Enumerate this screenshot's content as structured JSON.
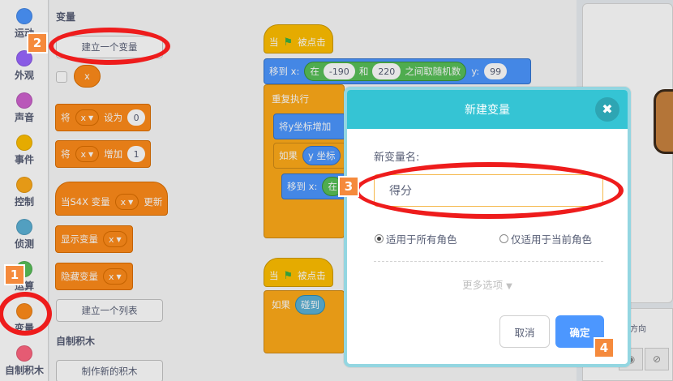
{
  "categories": [
    {
      "label": "运动",
      "color": "#4c97ff"
    },
    {
      "label": "外观",
      "color": "#9966ff"
    },
    {
      "label": "声音",
      "color": "#cf63cf"
    },
    {
      "label": "事件",
      "color": "#ffbf00"
    },
    {
      "label": "控制",
      "color": "#ffab19"
    },
    {
      "label": "侦测",
      "color": "#5cb1d6"
    },
    {
      "label": "运算",
      "color": "#59c059"
    },
    {
      "label": "变量",
      "color": "#ff8c1a"
    },
    {
      "label": "自制积木",
      "color": "#ff6680"
    }
  ],
  "palette": {
    "heading_variables": "变量",
    "make_variable_button": "建立一个变量",
    "var_reporter": "x",
    "set_block": {
      "verb": "将",
      "var": "x",
      "op": "设为",
      "value": "0"
    },
    "change_block": {
      "verb": "将",
      "var": "x",
      "op": "增加",
      "value": "1"
    },
    "when_var_block": {
      "prefix": "当S4X 变量",
      "var": "x",
      "suffix": "更新"
    },
    "show_var_block": {
      "label": "显示变量",
      "var": "x"
    },
    "hide_var_block": {
      "label": "隐藏变量",
      "var": "x"
    },
    "make_list_button": "建立一个列表",
    "heading_custom": "自制积木",
    "make_block_button": "制作新的积木"
  },
  "code": {
    "hat1": {
      "prefix": "当",
      "suffix": "被点击"
    },
    "goto": {
      "label": "移到 x:",
      "in": "在",
      "low": "-190",
      "and": "和",
      "high": "220",
      "rand": "之间取随机数",
      "ylabel": "y:",
      "y": "99"
    },
    "forever": "重复执行",
    "change_y": "将y坐标增加",
    "if_label": "如果",
    "if_cond": "y 坐标",
    "goto2_label": "移到 x:",
    "goto2_in": "在",
    "hat2": {
      "prefix": "当",
      "suffix": "被点击"
    },
    "if2_label": "如果",
    "touch_label": "碰到"
  },
  "sprite_panel": {
    "direction_text": "方向"
  },
  "dialog": {
    "title": "新建变量",
    "close_glyph": "✖",
    "name_label": "新变量名:",
    "name_value": "得分",
    "radio_all": "适用于所有角色",
    "radio_this": "仅适用于当前角色",
    "radio_selected": "all",
    "more_options": "更多选项",
    "cancel": "取消",
    "ok": "确定"
  },
  "annotations": {
    "badge1": "1",
    "badge2": "2",
    "badge3": "3",
    "badge4": "4",
    "ring_color": "#ee1c1c",
    "badge_color": "#f58a3c"
  }
}
